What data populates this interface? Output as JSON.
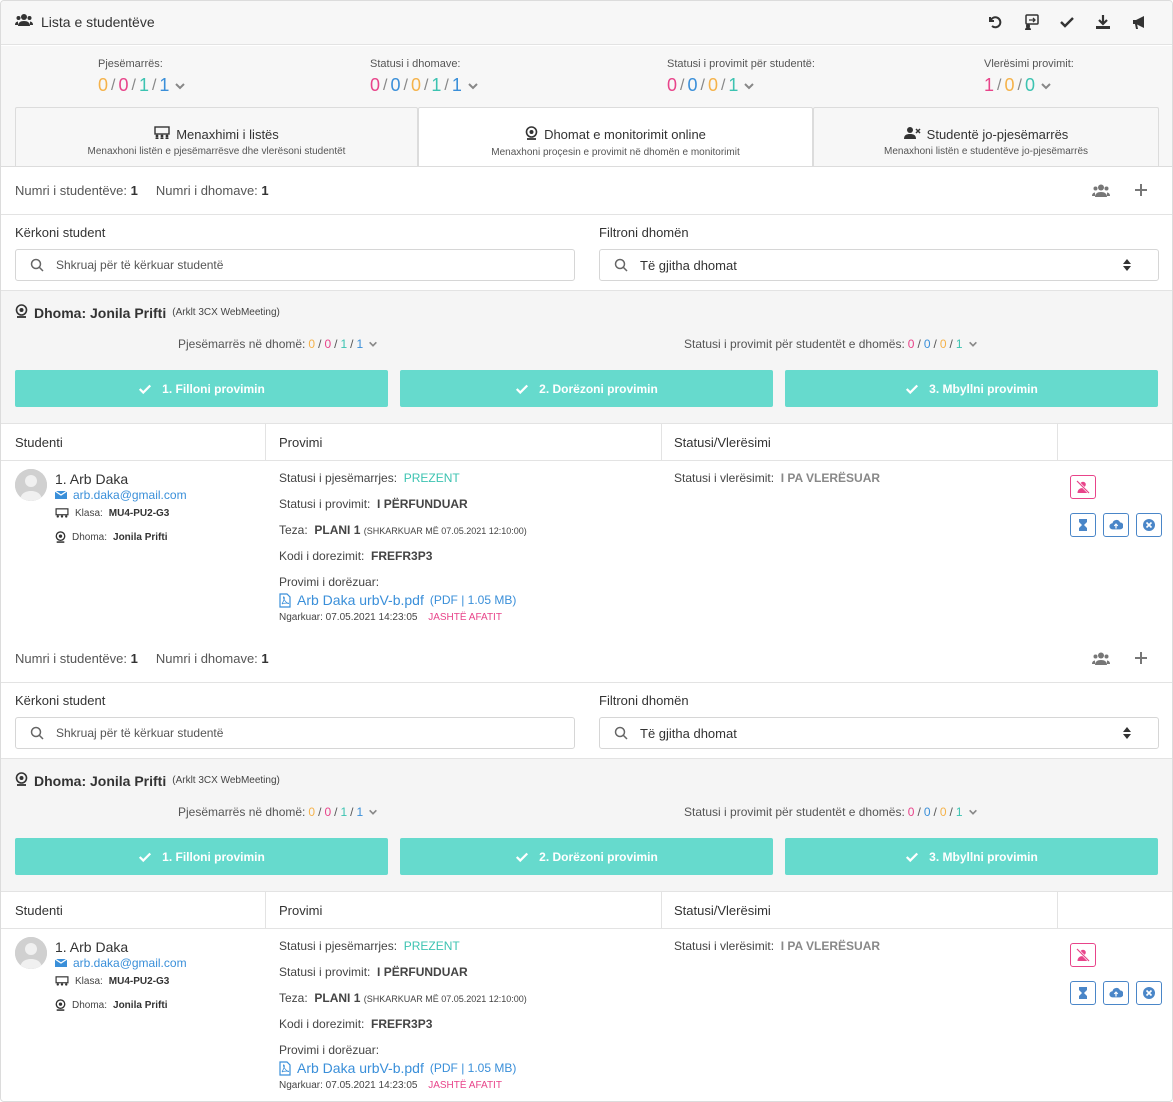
{
  "header": {
    "title": "Lista e studentëve",
    "tools": [
      "undo-icon",
      "transfer-icon",
      "check-icon",
      "download-icon",
      "megaphone-icon"
    ]
  },
  "stats": [
    {
      "label": "Pjesëmarrës:",
      "values": [
        {
          "v": "0",
          "c": "#f5b24a"
        },
        {
          "v": "0",
          "c": "#e8448a"
        },
        {
          "v": "1",
          "c": "#3cc3b1"
        },
        {
          "v": "1",
          "c": "#3a8fd9"
        }
      ]
    },
    {
      "label": "Statusi i dhomave:",
      "values": [
        {
          "v": "0",
          "c": "#e8448a"
        },
        {
          "v": "0",
          "c": "#3a8fd9"
        },
        {
          "v": "0",
          "c": "#f5b24a"
        },
        {
          "v": "1",
          "c": "#3cc3b1"
        },
        {
          "v": "1",
          "c": "#3a8fd9"
        }
      ]
    },
    {
      "label": "Statusi i provimit për studentë:",
      "values": [
        {
          "v": "0",
          "c": "#e8448a"
        },
        {
          "v": "0",
          "c": "#3a8fd9"
        },
        {
          "v": "0",
          "c": "#f5b24a"
        },
        {
          "v": "1",
          "c": "#3cc3b1"
        }
      ]
    },
    {
      "label": "Vlerësimi provimit:",
      "values": [
        {
          "v": "1",
          "c": "#e8448a"
        },
        {
          "v": "0",
          "c": "#f5b24a"
        },
        {
          "v": "0",
          "c": "#3cc3b1"
        }
      ]
    }
  ],
  "tabs": [
    {
      "title": "Menaxhimi i listës",
      "subtitle": "Menaxhoni listën e pjesëmarrësve dhe vlerësoni studentët",
      "icon": "classroom-icon",
      "active": false
    },
    {
      "title": "Dhomat e monitorimit online",
      "subtitle": "Menaxhoni proçesin e provimit në dhomën e monitorimit",
      "icon": "webcam-icon",
      "active": true
    },
    {
      "title": "Studentë jo-pjesëmarrës",
      "subtitle": "Menaxhoni listën e studentëve jo-pjesëmarrës",
      "icon": "user-x-icon",
      "active": false
    }
  ],
  "section": {
    "count_students_label": "Numri i studentëve:",
    "count_students": "1",
    "count_rooms_label": "Numri i dhomave:",
    "count_rooms": "1",
    "search_label": "Kërkoni student",
    "search_placeholder": "Shkruaj për të kërkuar studentë",
    "filter_label": "Filtroni dhomën",
    "filter_value": "Të gjitha dhomat",
    "room_title": "Dhoma: Jonila Prifti",
    "room_sub": "(Arklt 3CX WebMeeting)",
    "room_part_label": "Pjesëmarrës në dhomë:",
    "room_part_values": [
      {
        "v": "0",
        "c": "#f5b24a"
      },
      {
        "v": "0",
        "c": "#e8448a"
      },
      {
        "v": "1",
        "c": "#3cc3b1"
      },
      {
        "v": "1",
        "c": "#3a8fd9"
      }
    ],
    "room_status_label": "Statusi i provimit për studentët e dhomës:",
    "room_status_values": [
      {
        "v": "0",
        "c": "#e8448a"
      },
      {
        "v": "0",
        "c": "#3a8fd9"
      },
      {
        "v": "0",
        "c": "#f5b24a"
      },
      {
        "v": "1",
        "c": "#3cc3b1"
      }
    ],
    "buttons": [
      "1. Filloni provimin",
      "2. Dorëzoni provimin",
      "3. Mbyllni provimin"
    ],
    "col_student": "Studenti",
    "col_exam": "Provimi",
    "col_status": "Statusi/Vlerësimi",
    "student": {
      "name": "1. Arb Daka",
      "email": "arb.daka@gmail.com",
      "class_label": "Klasa:",
      "class_value": "MU4-PU2-G3",
      "room_label": "Dhoma:",
      "room_value": "Jonila Prifti"
    },
    "exam": {
      "attendance_label": "Statusi i pjesëmarrjes:",
      "attendance_value": "PREZENT",
      "status_label": "Statusi i provimit:",
      "status_value": "I PËRFUNDUAR",
      "thesis_label": "Teza:",
      "thesis_value": "PLANI 1",
      "thesis_note": "(SHKARKUAR MË 07.05.2021 12:10:00)",
      "code_label": "Kodi i dorezimit:",
      "code_value": "FREFR3P3",
      "submitted_label": "Provimi i dorëzuar:",
      "file_name": "Arb Daka urbV-b.pdf",
      "file_size": "(PDF | 1.05 MB)",
      "uploaded_label": "Ngarkuar: 07.05.2021 14:23:05",
      "late": "JASHTË AFATIT"
    },
    "grade_label": "Statusi i vlerësimit:",
    "grade_value": "I PA VLERËSUAR"
  }
}
